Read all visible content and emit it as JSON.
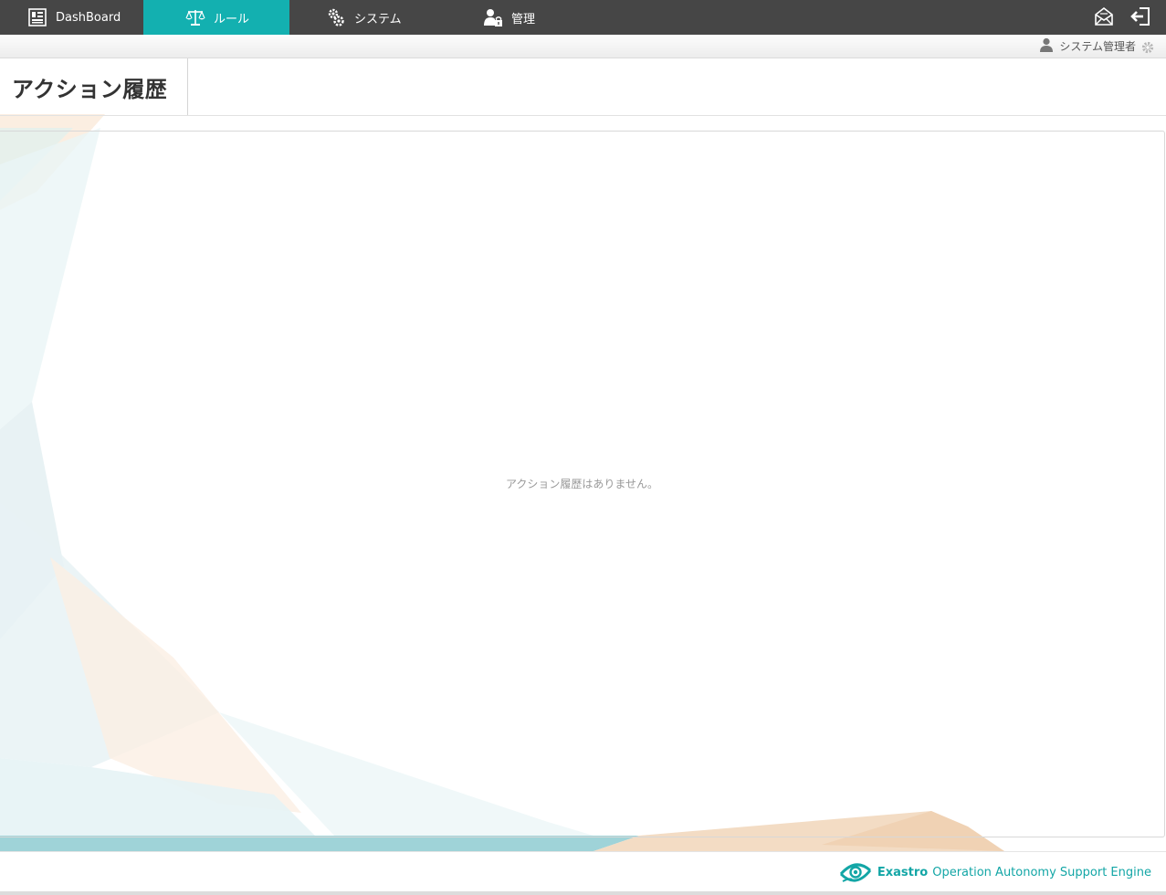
{
  "nav": {
    "items": [
      {
        "label": "DashBoard",
        "icon": "dashboard-icon"
      },
      {
        "label": "ルール",
        "icon": "scales-icon",
        "active": true
      },
      {
        "label": "システム",
        "icon": "gears-icon"
      },
      {
        "label": "管理",
        "icon": "user-lock-icon"
      }
    ],
    "right_icons": [
      "mail-icon",
      "logout-icon"
    ]
  },
  "user": {
    "name": "システム管理者",
    "icon": "user-icon",
    "settings_icon": "gear-icon"
  },
  "page": {
    "title": "アクション履歴",
    "empty_message": "アクション履歴はありません。"
  },
  "footer": {
    "brand_name": "Exastro",
    "brand_tagline": "Operation Autonomy Support Engine",
    "logo_icon": "exastro-eye-logo-icon"
  },
  "colors": {
    "nav_bg": "#464646",
    "accent": "#13b0b0",
    "brand": "#13a6a6"
  }
}
